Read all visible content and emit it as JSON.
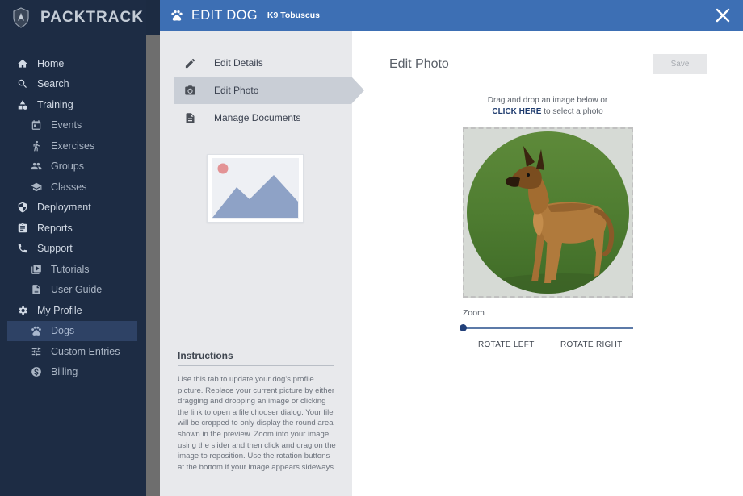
{
  "app": {
    "name": "PACKTRACK"
  },
  "sidebar": {
    "items": [
      {
        "label": "Home",
        "icon": "home-icon",
        "level": "top"
      },
      {
        "label": "Search",
        "icon": "search-icon",
        "level": "top"
      },
      {
        "label": "Training",
        "icon": "training-icon",
        "level": "top"
      },
      {
        "label": "Events",
        "icon": "calendar-icon",
        "level": "sub"
      },
      {
        "label": "Exercises",
        "icon": "running-icon",
        "level": "sub"
      },
      {
        "label": "Groups",
        "icon": "people-icon",
        "level": "sub"
      },
      {
        "label": "Classes",
        "icon": "school-icon",
        "level": "sub"
      },
      {
        "label": "Deployment",
        "icon": "shield-icon",
        "level": "top"
      },
      {
        "label": "Reports",
        "icon": "clipboard-icon",
        "level": "top"
      },
      {
        "label": "Support",
        "icon": "phone-icon",
        "level": "top"
      },
      {
        "label": "Tutorials",
        "icon": "video-icon",
        "level": "sub"
      },
      {
        "label": "User Guide",
        "icon": "document-icon",
        "level": "sub"
      },
      {
        "label": "My Profile",
        "icon": "gear-icon",
        "level": "top"
      },
      {
        "label": "Dogs",
        "icon": "paw-icon",
        "level": "sub",
        "active": true
      },
      {
        "label": "Custom Entries",
        "icon": "sliders-icon",
        "level": "sub"
      },
      {
        "label": "Billing",
        "icon": "dollar-icon",
        "level": "sub"
      }
    ]
  },
  "modal": {
    "title": "EDIT DOG",
    "subtitle": "K9 Tobuscus",
    "menu": [
      {
        "label": "Edit Details",
        "icon": "pencil-icon"
      },
      {
        "label": "Edit Photo",
        "icon": "camera-icon",
        "active": true
      },
      {
        "label": "Manage Documents",
        "icon": "document-icon"
      }
    ],
    "instructions": {
      "title": "Instructions",
      "text": "Use this tab to update your dog's profile picture. Replace your current picture by either dragging and dropping an image or clicking the link to open a file chooser dialog. Your file will be cropped to only display the round area shown in the preview. Zoom into your image using the slider and then click and drag on the image to reposition. Use the rotation buttons at the bottom if your image appears sideways."
    },
    "photo": {
      "section_title": "Edit Photo",
      "save_label": "Save",
      "drop_text_line1": "Drag and drop an image below or",
      "click_here": "CLICK HERE",
      "drop_text_suffix": " to select a photo",
      "zoom_label": "Zoom",
      "zoom_value": 0,
      "rotate_left": "ROTATE LEFT",
      "rotate_right": "ROTATE RIGHT"
    }
  },
  "colors": {
    "sidebar_bg": "#1d2c44",
    "header_bg": "#3d6fb4",
    "accent": "#22407a",
    "panel_bg": "#e8e9ec"
  }
}
